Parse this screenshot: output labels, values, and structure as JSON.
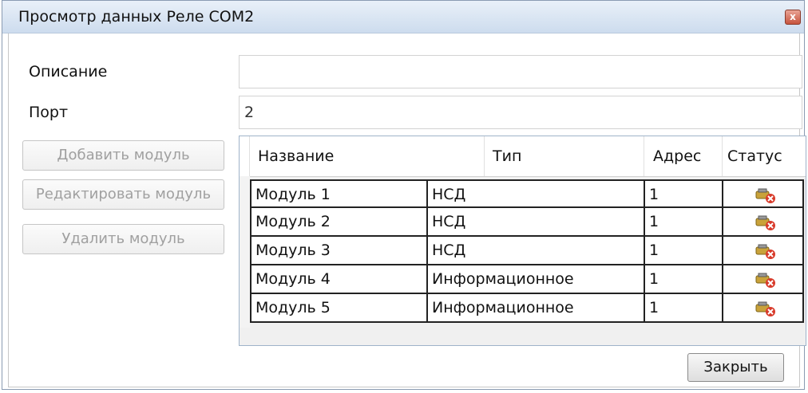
{
  "window": {
    "title": "Просмотр данных Реле COM2",
    "close_glyph": "x"
  },
  "form": {
    "description_label": "Описание",
    "description_value": "",
    "port_label": "Порт",
    "port_value": "2"
  },
  "buttons": {
    "add": "Добавить модуль",
    "edit": "Редактировать модуль",
    "delete": "Удалить модуль",
    "close": "Закрыть"
  },
  "table": {
    "columns": [
      "Название",
      "Тип",
      "Адрес",
      "Статус"
    ],
    "rows": [
      {
        "name": "Модуль 1",
        "type": "НСД",
        "address": "1",
        "status_icon": "device-error-icon"
      },
      {
        "name": "Модуль 2",
        "type": "НСД",
        "address": "1",
        "status_icon": "device-error-icon"
      },
      {
        "name": "Модуль 3",
        "type": "НСД",
        "address": "1",
        "status_icon": "device-error-icon"
      },
      {
        "name": "Модуль 4",
        "type": "Информационное",
        "address": "1",
        "status_icon": "device-error-icon"
      },
      {
        "name": "Модуль 5",
        "type": "Информационное",
        "address": "1",
        "status_icon": "device-error-icon"
      }
    ]
  },
  "colors": {
    "disabled_text": "#a0a0a0",
    "error_red": "#d83a2a"
  }
}
